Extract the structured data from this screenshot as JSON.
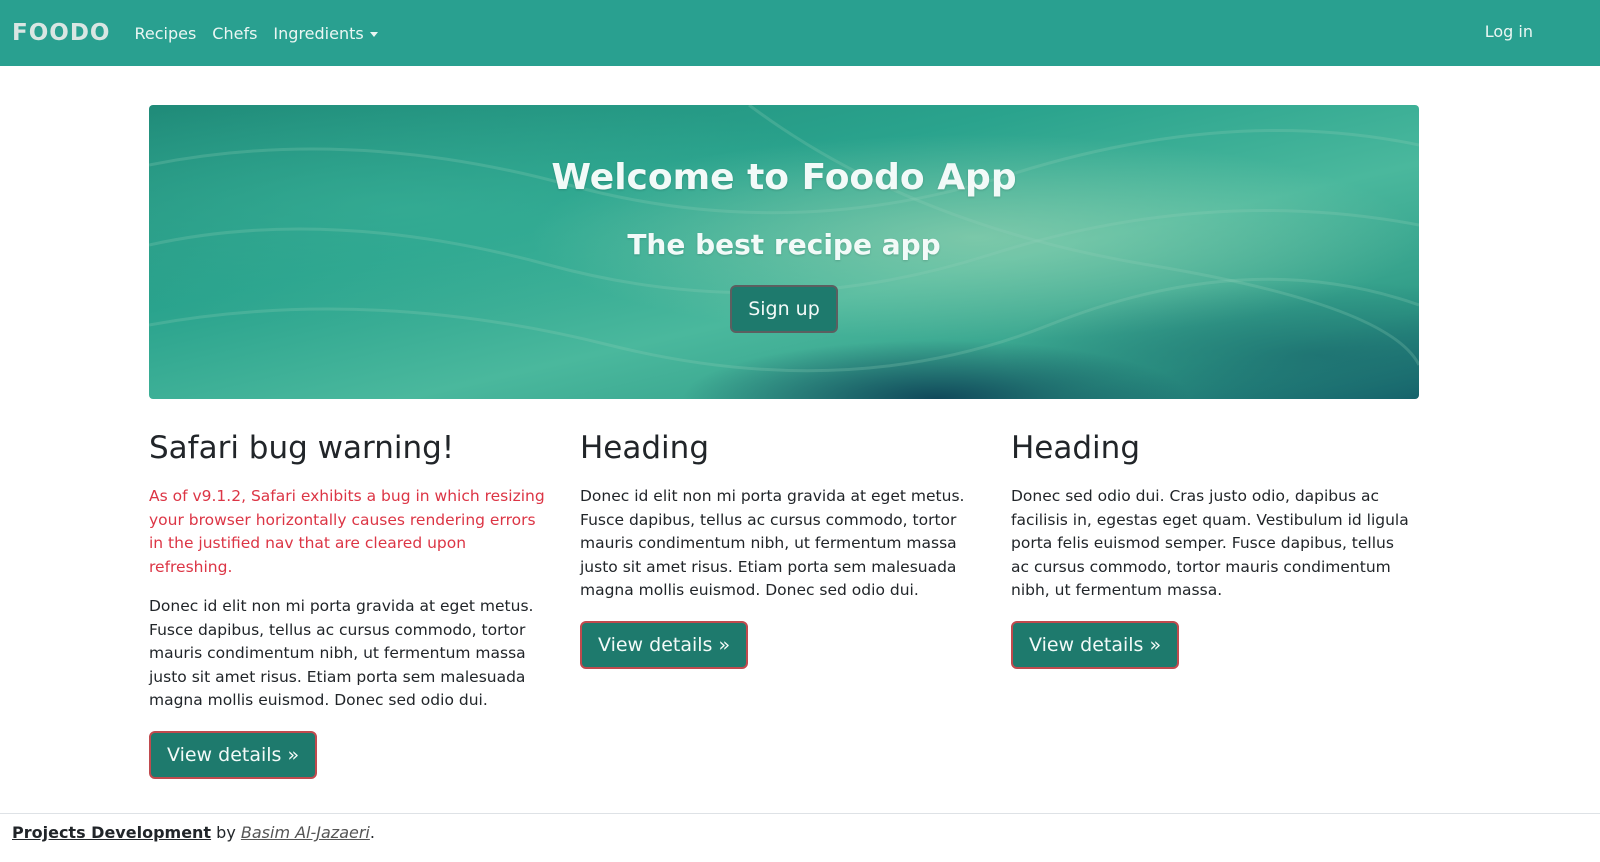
{
  "nav": {
    "brand": "FOODO",
    "links": [
      {
        "label": "Recipes"
      },
      {
        "label": "Chefs"
      },
      {
        "label": "Ingredients"
      }
    ],
    "login": "Log in"
  },
  "hero": {
    "title": "Welcome to Foodo App",
    "subtitle": "The best recipe app",
    "cta": "Sign up"
  },
  "columns": [
    {
      "heading": "Safari bug warning!",
      "warning": "As of v9.1.2, Safari exhibits a bug in which resizing your browser horizontally causes rendering errors in the justified nav that are cleared upon refreshing.",
      "text": "Donec id elit non mi porta gravida at eget metus. Fusce dapibus, tellus ac cursus commodo, tortor mauris condimentum nibh, ut fermentum massa justo sit amet risus. Etiam porta sem malesuada magna mollis euismod. Donec sed odio dui.",
      "button": "View details »"
    },
    {
      "heading": "Heading",
      "text": "Donec id elit non mi porta gravida at eget metus. Fusce dapibus, tellus ac cursus commodo, tortor mauris condimentum nibh, ut fermentum massa justo sit amet risus. Etiam porta sem malesuada magna mollis euismod. Donec sed odio dui.",
      "button": "View details »"
    },
    {
      "heading": "Heading",
      "text": "Donec sed odio dui. Cras justo odio, dapibus ac facilisis in, egestas eget quam. Vestibulum id ligula porta felis euismod semper. Fusce dapibus, tellus ac cursus commodo, tortor mauris condimentum nibh, ut fermentum massa.",
      "button": "View details »"
    }
  ],
  "footer": {
    "project": "Projects Development",
    "by": " by ",
    "author": "Basim Al-Jazaeri",
    "end": "."
  },
  "colors": {
    "navbar": "#29a090",
    "button": "#1e7a6d",
    "warning": "#dc3545"
  }
}
